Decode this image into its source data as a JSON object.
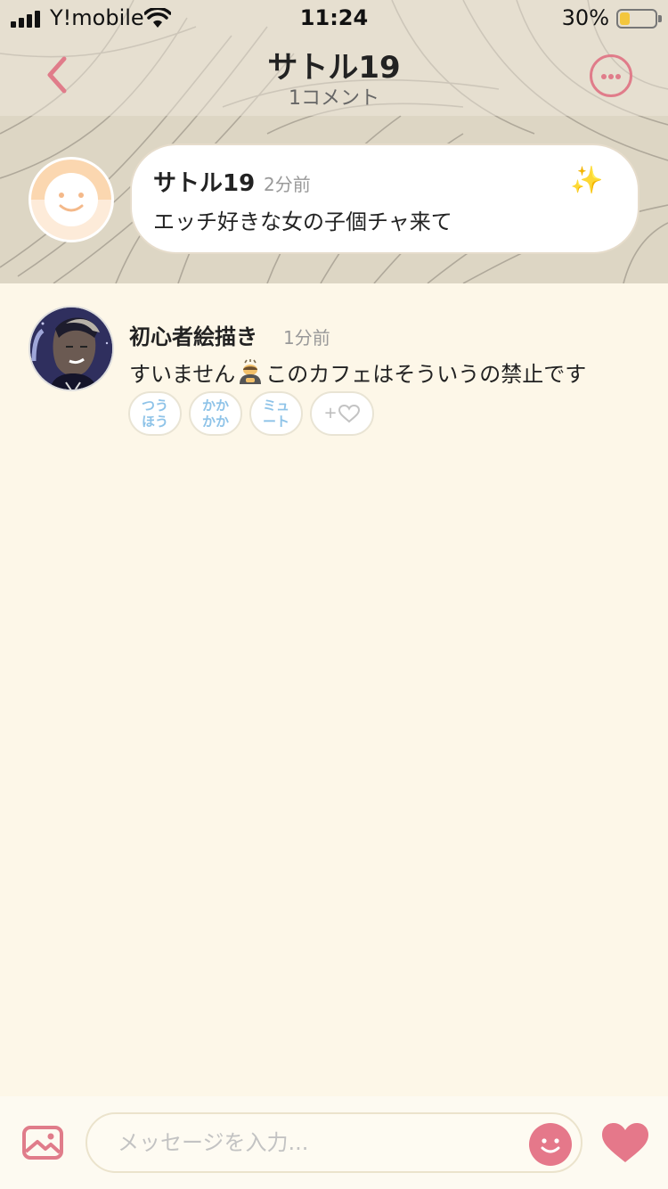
{
  "status_bar": {
    "carrier": "Y!mobile",
    "time": "11:24",
    "battery_percent": "30%",
    "battery_level": 0.3
  },
  "nav": {
    "title": "サトル19",
    "subtitle": "1コメント"
  },
  "post": {
    "author": "サトル19",
    "time": "2分前",
    "text": "エッチ好きな女の子個チャ来て",
    "sparkle": "✨"
  },
  "comment": {
    "author": "初心者絵描き",
    "time": "1分前",
    "text_before": "すいません",
    "text_after": "このカフェはそういうの禁止です",
    "actions": {
      "report_line1": "つう",
      "report_line2": "ほう",
      "kakaka_line1": "かか",
      "kakaka_line2": "かか",
      "mute_line1": "ミュ",
      "mute_line2": "ート",
      "like_prefix": "+"
    }
  },
  "input": {
    "placeholder": "メッセージを入力..."
  },
  "colors": {
    "accent": "#e07c8a",
    "background": "#fdf7e8",
    "pill_text": "#8ec3e8"
  },
  "icons": {
    "back": "chevron-left-icon",
    "more": "more-dots-icon",
    "image": "image-icon",
    "emoji": "smile-icon",
    "like": "heart-icon"
  }
}
